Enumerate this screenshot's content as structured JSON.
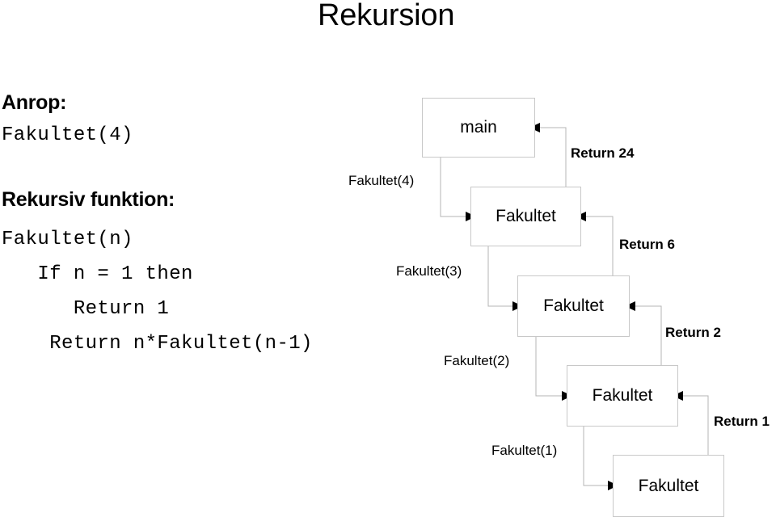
{
  "slide": {
    "title": "Rekursion",
    "background_color": "#ffffff",
    "text_color": "#000000",
    "box_border_color": "#c8c8c8",
    "connector_color": "#b4b4b4",
    "arrow_color": "#000000"
  },
  "left_panel": {
    "call_heading": "Anrop:",
    "call_code": "Fakultet(4)",
    "function_heading": "Rekursiv funktion:",
    "function_code": [
      "Fakultet(n)",
      "   If n = 1 then",
      "      Return 1",
      "    Return n*Fakultet(n-1)"
    ]
  },
  "diagram": {
    "boxes": [
      {
        "id": "main",
        "label": "main"
      },
      {
        "id": "fakultet1",
        "label": "Fakultet"
      },
      {
        "id": "fakultet2",
        "label": "Fakultet"
      },
      {
        "id": "fakultet3",
        "label": "Fakultet"
      },
      {
        "id": "fakultet4",
        "label": "Fakultet"
      }
    ],
    "call_labels": [
      "Fakultet(4)",
      "Fakultet(3)",
      "Fakultet(2)",
      "Fakultet(1)"
    ],
    "return_labels": [
      "Return 24",
      "Return 6",
      "Return 2",
      "Return 1"
    ]
  }
}
